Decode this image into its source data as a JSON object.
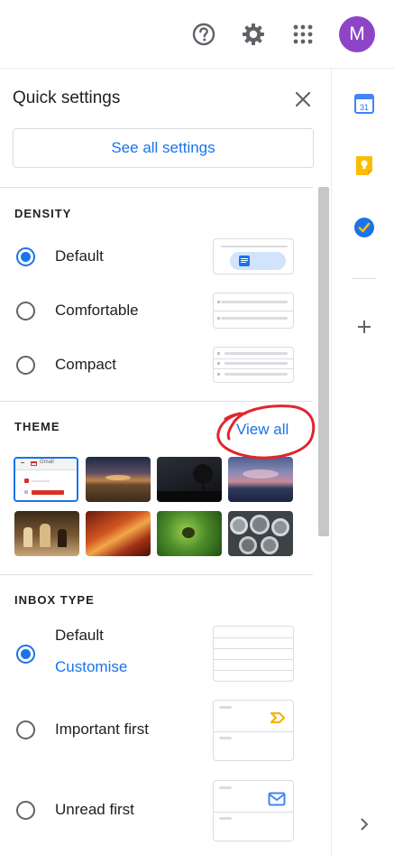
{
  "header": {
    "icons": [
      "help-icon",
      "settings-gear-icon",
      "apps-grid-icon"
    ],
    "avatar_initial": "M"
  },
  "quick_settings": {
    "title": "Quick settings",
    "close_icon": "close-icon",
    "see_all_label": "See all settings"
  },
  "density": {
    "title": "DENSITY",
    "options": [
      {
        "label": "Default",
        "selected": true
      },
      {
        "label": "Comfortable",
        "selected": false
      },
      {
        "label": "Compact",
        "selected": false
      }
    ]
  },
  "theme": {
    "title": "THEME",
    "view_all_label": "View all",
    "thumbnails": [
      {
        "name": "default-gmail",
        "selected": true
      },
      {
        "name": "sunset-field"
      },
      {
        "name": "night-tree"
      },
      {
        "name": "sea-clouds"
      },
      {
        "name": "chess"
      },
      {
        "name": "canyon"
      },
      {
        "name": "green-insect"
      },
      {
        "name": "pipes"
      }
    ],
    "thumb_mini_label": "Gmail"
  },
  "inbox_type": {
    "title": "INBOX TYPE",
    "options": [
      {
        "label": "Default",
        "selected": true,
        "sub_link": "Customise"
      },
      {
        "label": "Important first",
        "selected": false
      },
      {
        "label": "Unread first",
        "selected": false
      }
    ]
  },
  "side_panel": {
    "apps": [
      "calendar-icon",
      "keep-icon",
      "tasks-icon"
    ],
    "calendar_day": "31",
    "add_icon": "plus-icon",
    "expand_icon": "chevron-right-icon"
  },
  "colors": {
    "accent": "#1a73e8",
    "avatar": "#8e44c7",
    "annotation": "#e0262e"
  }
}
